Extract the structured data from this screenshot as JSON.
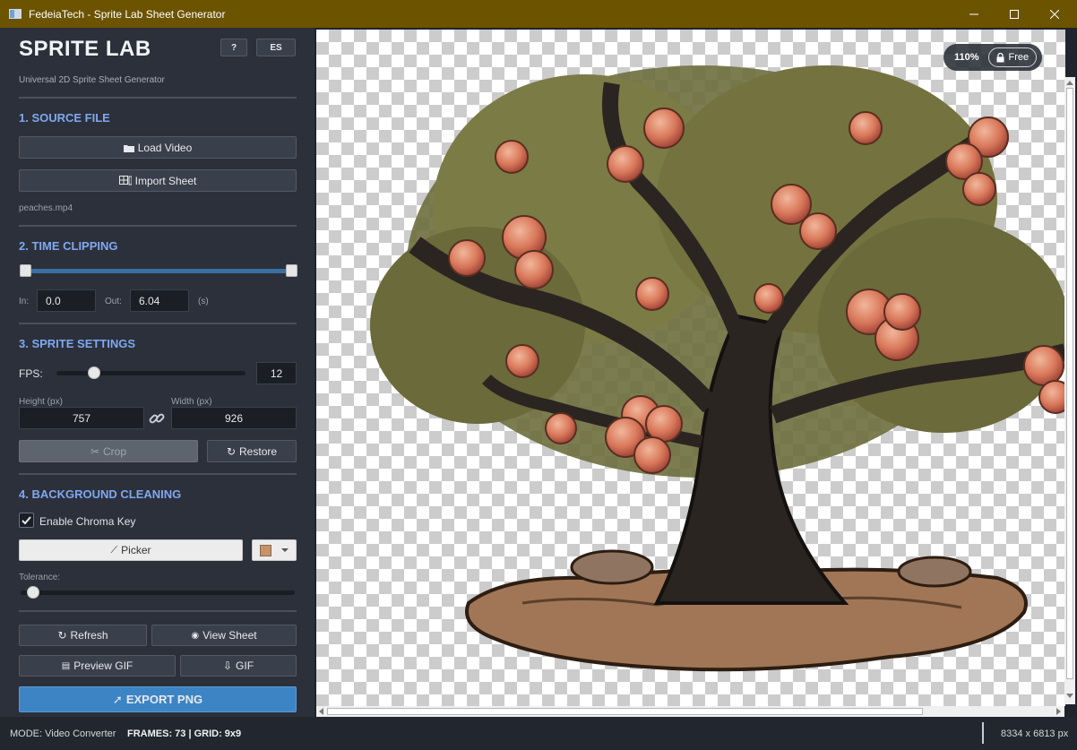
{
  "window": {
    "title": "FedeiaTech - Sprite Lab Sheet Generator",
    "minimize": "—",
    "maximize": "☐",
    "close": "✕"
  },
  "header": {
    "app_title": "SPRITE LAB",
    "subtitle": "Universal 2D Sprite Sheet Generator",
    "help_label": "?",
    "lang_label": "ES"
  },
  "source": {
    "heading": "1. SOURCE FILE",
    "load_video": "Load Video",
    "import_sheet": "Import Sheet",
    "filename": "peaches.mp4",
    "load_icon": "folder-icon",
    "import_icon": "sheet-icon"
  },
  "clipping": {
    "heading": "2. TIME CLIPPING",
    "in_label": "In:",
    "in_value": "0.0",
    "out_label": "Out:",
    "out_value": "6.04",
    "unit": "(s)"
  },
  "sprite": {
    "heading": "3. SPRITE SETTINGS",
    "fps_label": "FPS:",
    "fps_value": "12",
    "fps_slider_fraction": 0.2,
    "height_label": "Height (px)",
    "height_value": "757",
    "width_label": "Width (px)",
    "width_value": "926",
    "crop_label": "Crop",
    "restore_label": "Restore"
  },
  "background": {
    "heading": "4. BACKGROUND CLEANING",
    "chroma_label": "Enable Chroma Key",
    "chroma_checked": true,
    "picker_label": "Picker",
    "swatch_color": "#c8936a",
    "tolerance_label": "Tolerance:",
    "tolerance_fraction": 0.04
  },
  "actions": {
    "refresh": "Refresh",
    "view_sheet": "View Sheet",
    "preview_gif": "Preview GIF",
    "gif": "GIF",
    "export_png": "EXPORT PNG"
  },
  "viewer": {
    "zoom": "110%",
    "lock_label": "Free"
  },
  "status": {
    "mode": "MODE: Video Converter",
    "frames": "FRAMES: 73 | GRID: 9x9",
    "dimensions": "8334 x 6813 px"
  },
  "colors": {
    "accent": "#7fa8f0",
    "primary": "#3d84c4",
    "titlebar": "#6b5300",
    "sidebar": "#2b303a"
  }
}
